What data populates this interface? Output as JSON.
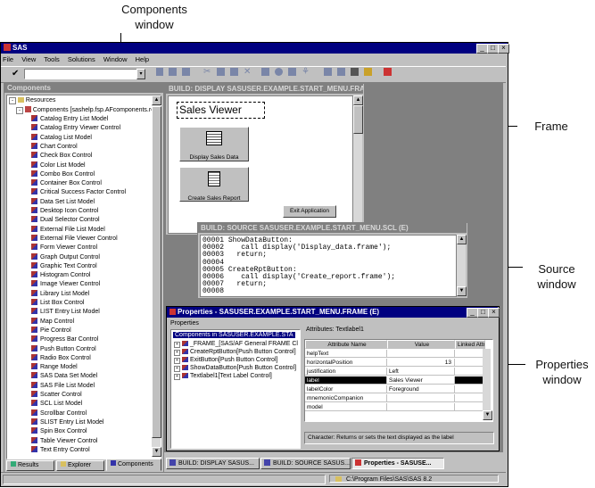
{
  "callouts": {
    "components": "Components\nwindow",
    "frame": "Frame",
    "source": "Source\nwindow",
    "properties": "Properties\nwindow"
  },
  "app": {
    "title": "SAS",
    "menu": [
      "File",
      "View",
      "Tools",
      "Solutions",
      "Window",
      "Help"
    ]
  },
  "components_window": {
    "title": "Components",
    "root": "Resources",
    "resource": "Components [sashelp.fsp.AFcomponents.reso",
    "items": [
      "Catalog Entry List Model",
      "Catalog Entry Viewer Control",
      "Catalog List Model",
      "Chart Control",
      "Check Box Control",
      "Color List Model",
      "Combo Box Control",
      "Container Box Control",
      "Critical Success Factor Control",
      "Data Set List Model",
      "Desktop Icon Control",
      "Dual Selector Control",
      "External File List Model",
      "External File Viewer Control",
      "Form Viewer Control",
      "Graph Output Control",
      "Graphic Text Control",
      "Histogram Control",
      "Image Viewer Control",
      "Library List Model",
      "List Box Control",
      "LIST Entry List Model",
      "Map Control",
      "Pie Control",
      "Progress Bar Control",
      "Push Button Control",
      "Radio Box Control",
      "Range Model",
      "SAS Data Set Model",
      "SAS File List Model",
      "Scatter Control",
      "SCL List Model",
      "Scrollbar Control",
      "SLIST Entry List Model",
      "Spin Box Control",
      "Table Viewer Control",
      "Text Entry Control"
    ],
    "tabs": [
      "Results",
      "Explorer",
      "Components"
    ]
  },
  "build_window": {
    "title": "BUILD: DISPLAY SASUSER.EXAMPLE.START_MENU.FRAME",
    "frame_title": "Sales Viewer",
    "btn_display": "Display Sales Data",
    "btn_create": "Create Sales Report",
    "btn_exit": "Exit Application"
  },
  "source_window": {
    "title": "BUILD: SOURCE SASUSER.EXAMPLE.START_MENU.SCL (E)",
    "lines": [
      {
        "n": "00001",
        "code": "ShowDataButton:"
      },
      {
        "n": "00002",
        "code": "   call display('Display_data.frame');"
      },
      {
        "n": "00003",
        "code": "  return;"
      },
      {
        "n": "00004",
        "code": ""
      },
      {
        "n": "00005",
        "code": "CreateRptButton:"
      },
      {
        "n": "00006",
        "code": "   call display('Create_report.frame');"
      },
      {
        "n": "00007",
        "code": "  return;"
      },
      {
        "n": "00008",
        "code": ""
      }
    ]
  },
  "properties_window": {
    "title": "Properties - SASUSER.EXAMPLE.START_MENU.FRAME (E)",
    "left_label": "Properties",
    "tree_root": "Components in SASUSER.EXAMPLE.STA",
    "tree_items": [
      "_FRAME_[SAS/AF General FRAME Cl",
      "CreateRptButton[Push Button Control]",
      "ExitButton[Push Button Control]",
      "ShowDataButton[Push Button Control]",
      "Textlabel1[Text Label Control]"
    ],
    "attrs_label": "Attributes: Textlabel1",
    "columns": [
      "Attribute Name",
      "Value",
      "Linked Attr"
    ],
    "rows": [
      {
        "name": "helpText",
        "value": ""
      },
      {
        "name": "horizontalPosition",
        "value": "13"
      },
      {
        "name": "justification",
        "value": "Left"
      },
      {
        "name": "label",
        "value": "Sales Viewer"
      },
      {
        "name": "labelColor",
        "value": "Foreground"
      },
      {
        "name": "mnemonicCompanion",
        "value": ""
      },
      {
        "name": "model",
        "value": ""
      }
    ],
    "description": "Character: Returns or sets the text displayed as the label"
  },
  "taskbar": {
    "items": [
      "BUILD: DISPLAY SASUS...",
      "BUILD: SOURCE SASUS...",
      "Properties - SASUSE..."
    ]
  },
  "status": {
    "path": "C:\\Program Files\\SAS\\SAS 8.2"
  }
}
